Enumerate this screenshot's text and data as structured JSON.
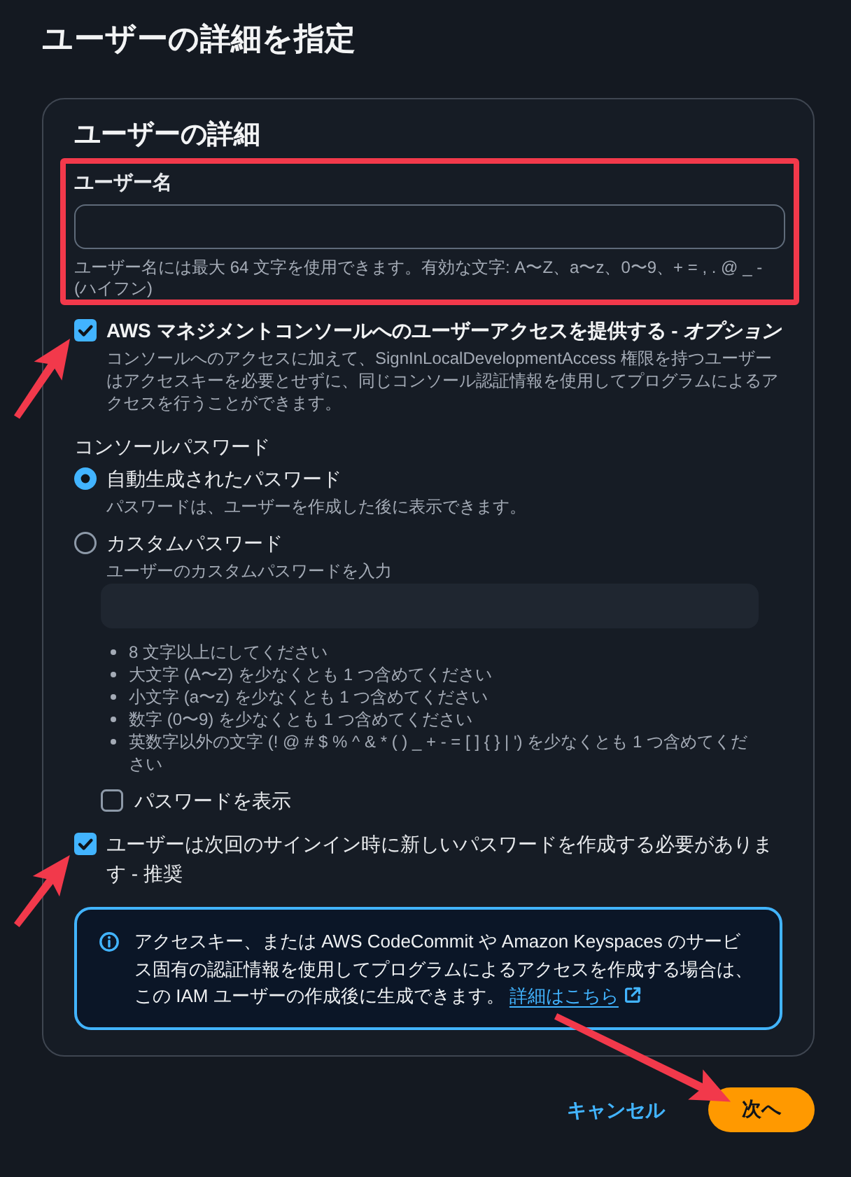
{
  "page_title": "ユーザーの詳細を指定",
  "user_details": {
    "heading": "ユーザーの詳細",
    "username": {
      "label": "ユーザー名",
      "hint": "ユーザー名には最大 64 文字を使用できます。有効な文字: A〜Z、a〜z、0〜9、+ = , . @ _ - (ハイフン)",
      "highlighted": true
    },
    "console_access": {
      "label": "AWS マネジメントコンソールへのユーザーアクセスを提供する - *オプション*",
      "description": "コンソールへのアクセスに加えて、SignInLocalDevelopmentAccess 権限を持つユーザーはアクセスキーを必要とせずに、同じコンソール認証情報を使用してプログラムによるアクセスを行うことができます。",
      "checked": true,
      "annotation_arrow": true
    },
    "console_password": {
      "label": "コンソールパスワード",
      "options": [
        {
          "label": "自動生成されたパスワード",
          "description": "パスワードは、ユーザーを作成した後に表示できます。",
          "selected": true
        },
        {
          "label": "カスタムパスワード",
          "description": "ユーザーのカスタムパスワードを入力",
          "selected": false
        }
      ],
      "password_field": {
        "disabled": true
      },
      "requirements": [
        "8 文字以上にしてください",
        "大文字 (A〜Z) を少なくとも 1 つ含めてください",
        "小文字 (a〜z) を少なくとも 1 つ含めてください",
        "数字 (0〜9) を少なくとも 1 つ含めてください",
        "英数字以外の文字 (! @ # $ % ^ & * ( ) _ + - = [ ] { } | ') を少なくとも 1 つ含めてください"
      ],
      "show_password": {
        "label": "パスワードを表示",
        "checked": false
      }
    },
    "require_reset": {
      "label": "ユーザーは次回のサインイン時に新しいパスワードを作成する必要があります - 推奨",
      "checked": true,
      "annotation_arrow": true
    },
    "info": {
      "text": "アクセスキー、または AWS CodeCommit や Amazon Keyspaces のサービス固有の認証情報を使用してプログラムによるアクセスを作成する場合は、この IAM ユーザーの作成後に生成できます。",
      "link": "詳細はこちら"
    }
  },
  "actions": {
    "cancel": "キャンセル",
    "next": {
      "label": "次へ",
      "annotation_arrow": true
    }
  }
}
